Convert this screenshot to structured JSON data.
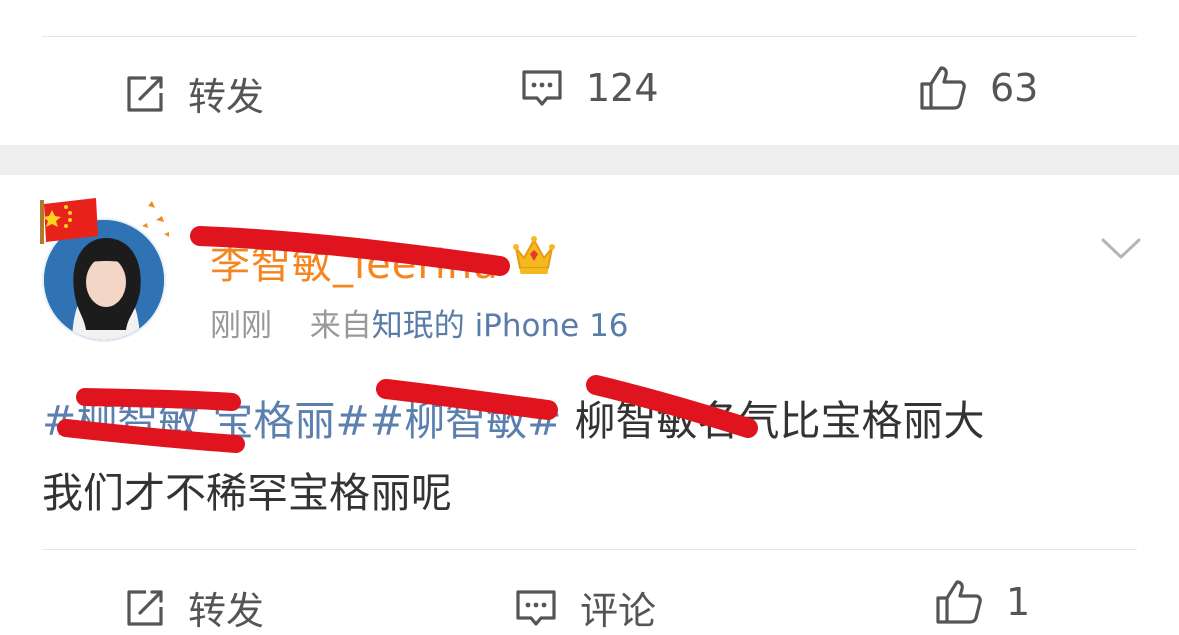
{
  "prev_post": {
    "actions": {
      "repost_label": "转发",
      "comment_count": "124",
      "like_count": "63"
    }
  },
  "post": {
    "author": {
      "name": "李智敏_leerina",
      "badge_icon": "crown-icon",
      "flag_icon": "china-flag-icon"
    },
    "meta": {
      "time": "刚刚",
      "from_prefix": "来自",
      "source": "知珉的 iPhone 16"
    },
    "content": {
      "tag1": "#柳智敏 宝格丽#",
      "tag2": "#柳智敏#",
      "text_line1_rest": " 柳智敏名气比宝格丽大",
      "text_line2": "我们才不稀罕宝格丽呢"
    },
    "actions": {
      "repost_label": "转发",
      "comment_label": "评论",
      "like_count": "1"
    }
  },
  "colors": {
    "username": "#f5861f",
    "hashtag": "#5b7fae",
    "redaction": "#e0141e"
  }
}
